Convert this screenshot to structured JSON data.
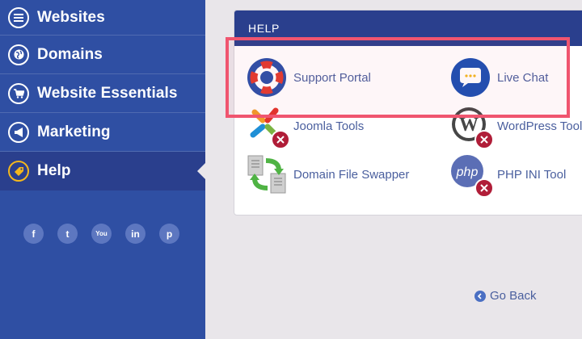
{
  "sidebar": {
    "items": [
      {
        "label": "Websites",
        "icon": "list-icon"
      },
      {
        "label": "Domains",
        "icon": "globe-icon"
      },
      {
        "label": "Website Essentials",
        "icon": "cart-icon"
      },
      {
        "label": "Marketing",
        "icon": "megaphone-icon"
      },
      {
        "label": "Help",
        "icon": "tag-icon",
        "active": true
      }
    ],
    "social": [
      "f",
      "t",
      "You",
      "in",
      "p"
    ]
  },
  "panel": {
    "title": "HELP",
    "tools": [
      {
        "label": "Support Portal",
        "icon": "lifebuoy-icon"
      },
      {
        "label": "Live Chat",
        "icon": "chat-bubble-icon"
      },
      {
        "label": "Joomla Tools",
        "icon": "joomla-icon"
      },
      {
        "label": "WordPress Tools",
        "icon": "wordpress-icon"
      },
      {
        "label": "Domain File Swapper",
        "icon": "file-swap-icon"
      },
      {
        "label": "PHP INI Tool",
        "icon": "php-icon",
        "icon_text": "php"
      }
    ]
  },
  "go_back": "Go Back",
  "colors": {
    "sidebar": "#2f4fa3",
    "active": "#2a3f8d",
    "accent": "#f3b71d",
    "highlight": "#f0556f",
    "link": "#4a5f9e"
  }
}
